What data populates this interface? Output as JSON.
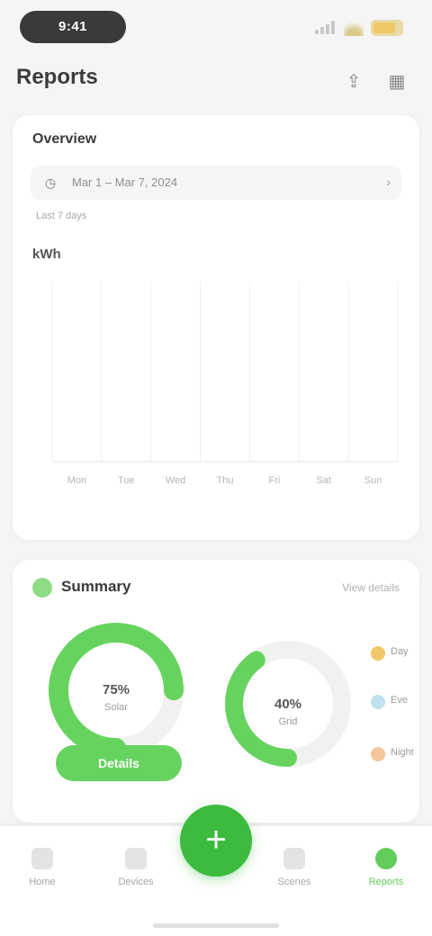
{
  "status_bar": {
    "time": "9:41"
  },
  "header": {
    "title": "Reports",
    "icons": [
      "share-icon",
      "calendar-icon"
    ]
  },
  "overview": {
    "label": "Overview",
    "date_range": "Mar 1 – Mar 7, 2024",
    "caption": "Last 7 days",
    "unit": "kWh"
  },
  "chart_data": {
    "type": "bar",
    "categories": [
      "Mon",
      "Tue",
      "Wed",
      "Thu",
      "Fri",
      "Sat",
      "Sun"
    ],
    "values": [
      0,
      0,
      0,
      0,
      0,
      0,
      0
    ],
    "ylim": [
      0,
      10
    ],
    "grid": true
  },
  "summary": {
    "title": "Summary",
    "link": "View details",
    "left_ring": {
      "value": "75%",
      "caption": "Solar",
      "progress": 0.75
    },
    "right_ring": {
      "value": "40%",
      "caption": "Grid",
      "progress": 0.4
    },
    "button_label": "Details",
    "legend": [
      {
        "label": "Day",
        "color": "#f3c86a"
      },
      {
        "label": "Eve",
        "color": "#bfe0ee"
      },
      {
        "label": "Night",
        "color": "#f2c79a"
      }
    ]
  },
  "nav": {
    "items": [
      {
        "label": "Home",
        "icon": "home-icon"
      },
      {
        "label": "Devices",
        "icon": "devices-icon"
      },
      {
        "label": "Scenes",
        "icon": "scenes-icon"
      },
      {
        "label": "Reports",
        "icon": "reports-icon"
      }
    ],
    "fab_label": "+"
  },
  "colors": {
    "accent": "#3dbb3f",
    "accent_light": "#67d35f"
  }
}
